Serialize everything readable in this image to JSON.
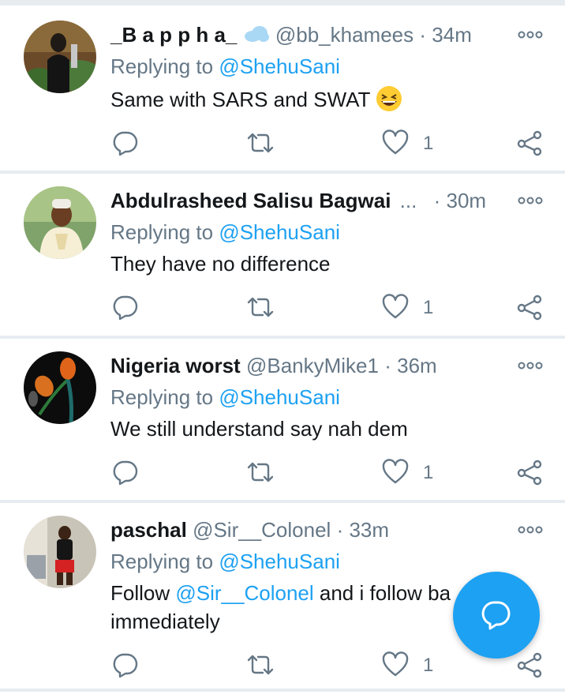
{
  "tweets": [
    {
      "name": "_B a p p h a_",
      "handle": "@bb_khamees",
      "dot": "·",
      "time": "34m",
      "replying_prefix": "Replying to",
      "replying_to": "@ShehuSani",
      "text": "Same with SARS and SWAT",
      "like_count": "1"
    },
    {
      "name": "Abdulrasheed Salisu Bagwai",
      "ellipsis": "...",
      "handle": "",
      "dot": "·",
      "time": "30m",
      "replying_prefix": "Replying to",
      "replying_to": "@ShehuSani",
      "text": "They have no difference",
      "like_count": "1"
    },
    {
      "name": "Nigeria worst",
      "handle": "@BankyMike1",
      "dot": "·",
      "time": "36m",
      "replying_prefix": "Replying to",
      "replying_to": "@ShehuSani",
      "text": "We still understand say nah dem",
      "like_count": "1"
    },
    {
      "name": "paschal",
      "handle": "@Sir__Colonel",
      "dot": "·",
      "time": "33m",
      "replying_prefix": "Replying to",
      "replying_to": "@ShehuSani",
      "text_prefix": "Follow",
      "text_mention": "@Sir__Colonel",
      "text_suffix": "and i follow ba",
      "text_line2": "immediately",
      "like_count": "1"
    }
  ],
  "colors": {
    "accent": "#1da1f2",
    "secondary_text": "#657786",
    "divider": "#e6ecf0"
  },
  "icons": {
    "reply": "reply-icon",
    "retweet": "retweet-icon",
    "like": "heart-icon",
    "share": "share-icon",
    "more": "more-options-icon",
    "compose": "compose-reply-icon"
  }
}
